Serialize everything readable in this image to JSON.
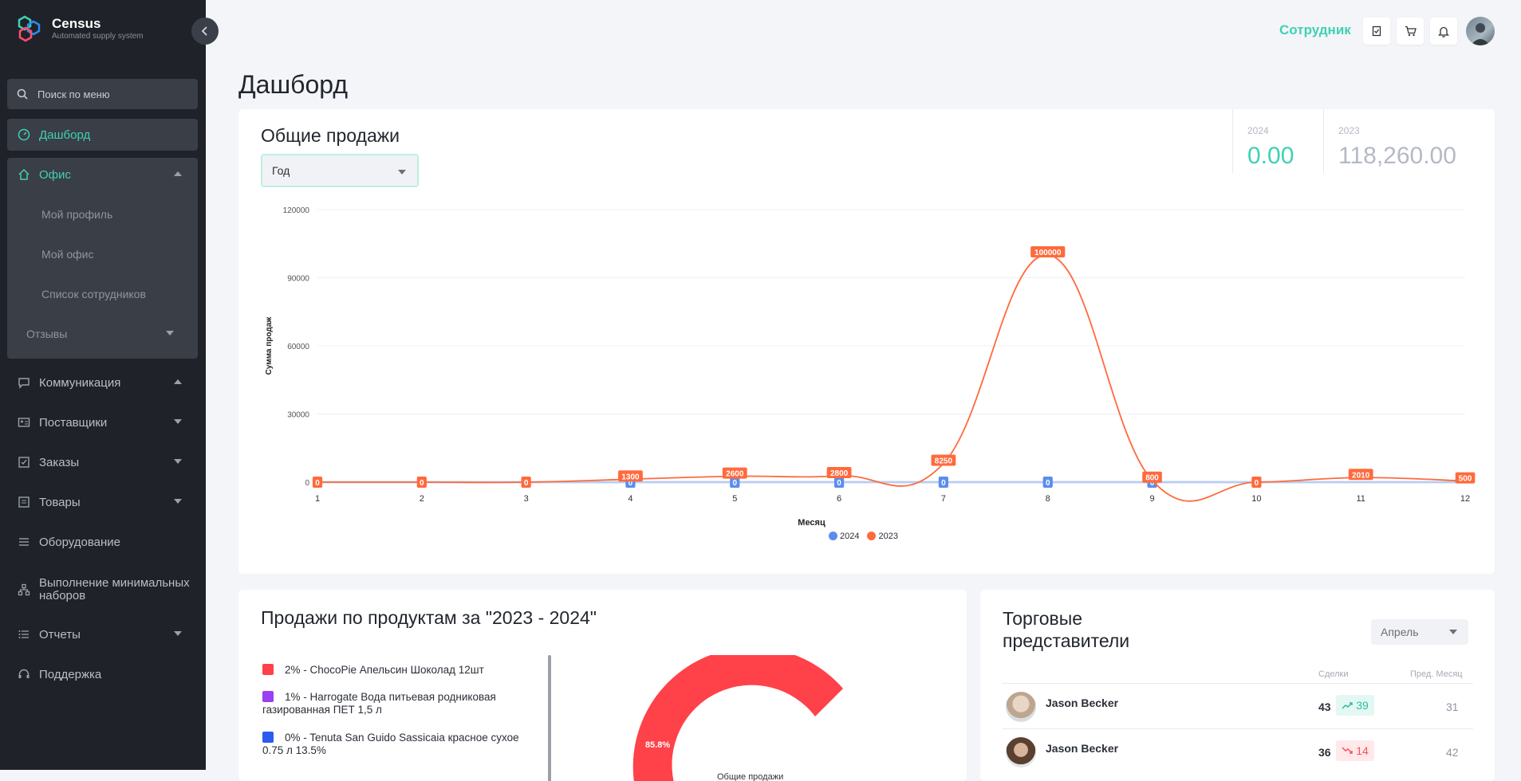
{
  "app": {
    "name": "Census",
    "tagline": "Automated supply system"
  },
  "sidebar": {
    "search_placeholder": "Поиск по меню",
    "items": [
      {
        "label": "Дашборд",
        "icon": "dashboard-icon"
      },
      {
        "label": "Офис",
        "icon": "home-icon"
      },
      {
        "label": "Коммуникация",
        "icon": "chat-icon"
      },
      {
        "label": "Поставщики",
        "icon": "id-card-icon"
      },
      {
        "label": "Заказы",
        "icon": "checkbox-icon"
      },
      {
        "label": "Товары",
        "icon": "box-icon"
      },
      {
        "label": "Оборудование",
        "icon": "equipment-icon"
      },
      {
        "label": "Выполнение минимальных наборов",
        "icon": "hierarchy-icon"
      },
      {
        "label": "Отчеты",
        "icon": "list-icon"
      },
      {
        "label": "Поддержка",
        "icon": "headset-icon"
      }
    ],
    "office_subitems": [
      "Мой профиль",
      "Мой офис",
      "Список сотрудников"
    ],
    "reviews_label": "Отзывы"
  },
  "header": {
    "role": "Сотрудник"
  },
  "page": {
    "title": "Дашборд"
  },
  "sales_card": {
    "title": "Общие продажи",
    "period_select": "Год",
    "stats": [
      {
        "year": "2024",
        "value": "0.00",
        "color": "#3fd1b4"
      },
      {
        "year": "2023",
        "value": "118,260.00",
        "color": "#b4bac4"
      }
    ]
  },
  "chart_data": {
    "type": "line",
    "x": [
      1,
      2,
      3,
      4,
      5,
      6,
      7,
      8,
      9,
      10,
      11,
      12
    ],
    "xlabel": "Месяц",
    "ylabel": "Сумма продаж",
    "ylim": [
      0,
      120000
    ],
    "yticks": [
      0,
      30000,
      60000,
      90000,
      120000
    ],
    "series": [
      {
        "name": "2024",
        "color": "#5b8def",
        "values": [
          0,
          0,
          0,
          0,
          0,
          0,
          0,
          0,
          0,
          0,
          0,
          0
        ]
      },
      {
        "name": "2023",
        "color": "#ff6a3d",
        "values": [
          0,
          0,
          0,
          1300,
          2600,
          2800,
          8250,
          100000,
          800,
          0,
          2010,
          500
        ]
      }
    ],
    "legend": "bottom"
  },
  "products_card": {
    "title": "Продажи по продуктам за \"2023 - 2024\"",
    "legend": [
      {
        "label": "2% - ChocoPie Апельсин Шоколад 12шт",
        "color": "#ff4149"
      },
      {
        "label": "1% - Harrogate Вода питьевая родниковая газированная ПЕТ 1,5 л",
        "color": "#9b3ff2"
      },
      {
        "label": "0% - Tenuta San Guido Sassicaia красное сухое 0.75 л 13.5%",
        "color": "#2b5cf0"
      }
    ],
    "donut_label": "85.8%",
    "donut_center": "Общие продажи"
  },
  "reps_card": {
    "title": "Торговые представители",
    "month": "Апрель",
    "col_deals": "Сделки",
    "col_prev": "Пред. Месяц",
    "rows": [
      {
        "name": "Jason Becker",
        "deals": "43",
        "change": "39",
        "trend": "up",
        "prev": "31"
      },
      {
        "name": "Jason Becker",
        "deals": "36",
        "change": "14",
        "trend": "down",
        "prev": "42"
      }
    ]
  }
}
